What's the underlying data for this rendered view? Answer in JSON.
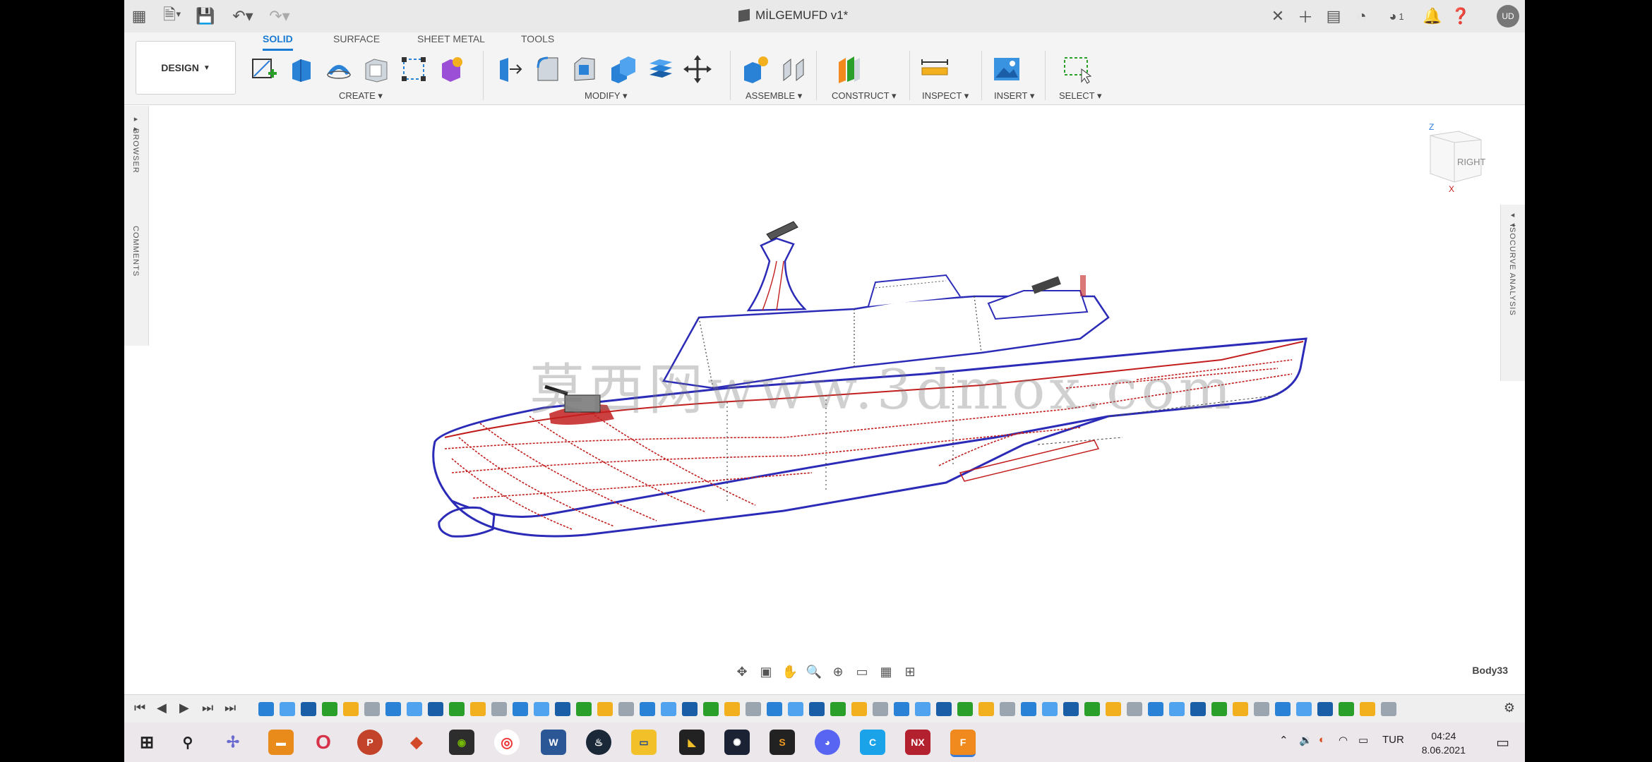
{
  "window": {
    "title": "MİLGEMUFD v1*",
    "user_initials": "UD",
    "job_count": "1"
  },
  "workspace": {
    "label": "DESIGN"
  },
  "tabs": [
    {
      "label": "SOLID"
    },
    {
      "label": "SURFACE"
    },
    {
      "label": "SHEET METAL"
    },
    {
      "label": "TOOLS"
    }
  ],
  "groups": {
    "create": "CREATE",
    "modify": "MODIFY",
    "assemble": "ASSEMBLE",
    "construct": "CONSTRUCT",
    "inspect": "INSPECT",
    "insert": "INSERT",
    "select": "SELECT"
  },
  "panels": {
    "browser": "BROWSER",
    "comments": "COMMENTS",
    "isocurve": "ISOCURVE ANALYSIS"
  },
  "viewcube": {
    "face": "RIGHT",
    "axis_z": "Z",
    "axis_x": "X"
  },
  "watermark": "莫西网www.3dmox.com",
  "status": {
    "selected_body": "Body33"
  },
  "taskbar": {
    "language": "TUR",
    "time": "04:24",
    "date": "8.06.2021"
  },
  "colors": {
    "accent": "#1a7bd4",
    "hull_blue": "#2b2bb8",
    "hull_red": "#c21e1e"
  }
}
